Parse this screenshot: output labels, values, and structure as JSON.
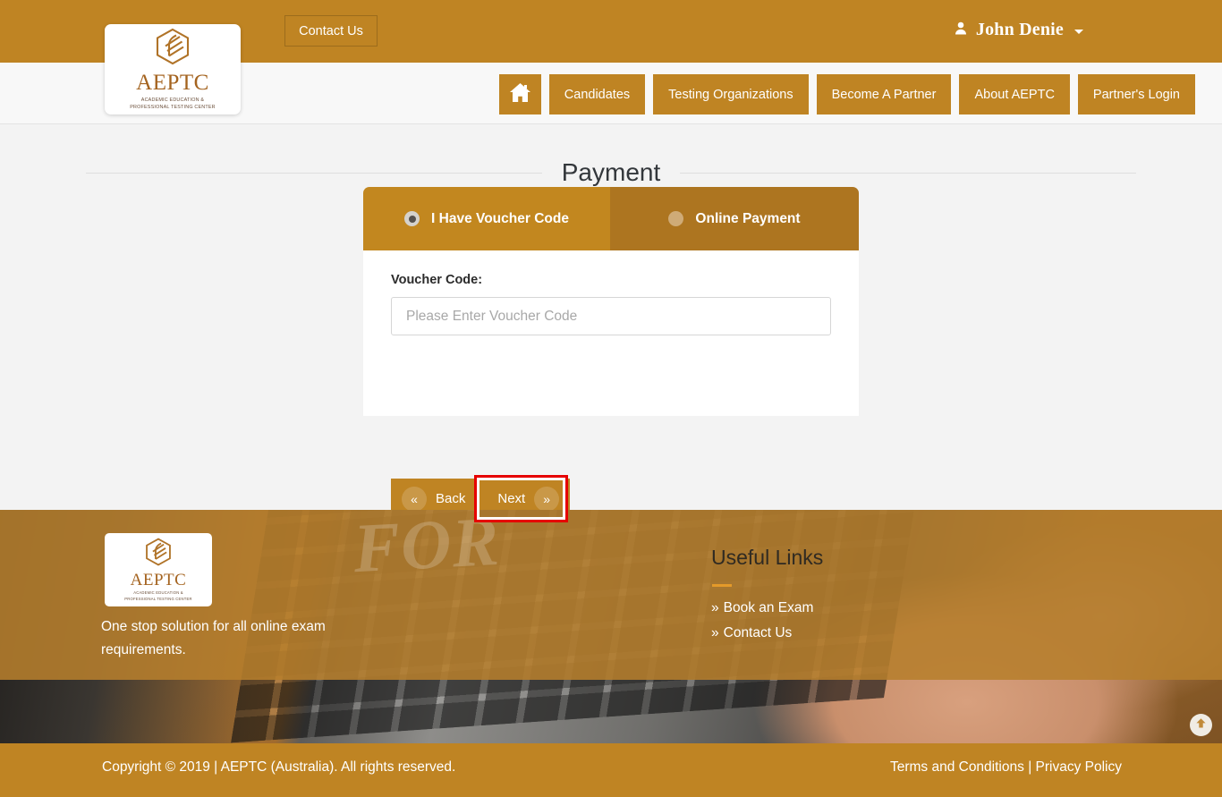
{
  "topbar": {
    "contact_button": "Contact Us",
    "user_name": "John Denie",
    "user_icon": "user-icon",
    "caret_icon": "chevron-down-icon"
  },
  "logo": {
    "word": "AEPTC",
    "tagline_line1": "ACADEMIC EDUCATION &",
    "tagline_line2": "PROFESSIONAL TESTING CENTER"
  },
  "nav": {
    "home_icon": "home-icon",
    "items": [
      {
        "label": "Candidates"
      },
      {
        "label": "Testing Organizations"
      },
      {
        "label": "Become A Partner"
      },
      {
        "label": "About AEPTC"
      },
      {
        "label": "Partner's Login"
      }
    ]
  },
  "main": {
    "page_title": "Payment",
    "tabs": [
      {
        "label": "I Have Voucher Code",
        "selected": true
      },
      {
        "label": "Online Payment",
        "selected": false
      }
    ],
    "form": {
      "voucher_label": "Voucher Code:",
      "voucher_value": "",
      "voucher_placeholder": "Please Enter Voucher Code"
    },
    "buttons": {
      "back_label": "Back",
      "back_icon": "chevron-double-left-icon",
      "back_glyph": "«",
      "next_label": "Next",
      "next_icon": "chevron-double-right-icon",
      "next_glyph": "»"
    }
  },
  "footer": {
    "watermark": "FOR",
    "tagline": "One stop solution for all online exam requirements.",
    "links_heading": "Useful Links",
    "links": [
      {
        "glyph": "»",
        "label": "Book an Exam"
      },
      {
        "glyph": "»",
        "label": "Contact Us"
      }
    ],
    "scroll_top_icon": "arrow-up-icon"
  },
  "copyright": {
    "text": "Copyright © 2019 | AEPTC (Australia). All rights reserved.",
    "terms": "Terms and Conditions",
    "separator": "|",
    "privacy": "Privacy Policy"
  },
  "colors": {
    "gold": "#bf8423",
    "gold_active_tab": "#c2871f",
    "gold_inactive_tab": "#ad7520",
    "highlight_red": "#e60000",
    "page_bg": "#f3f3f3"
  }
}
